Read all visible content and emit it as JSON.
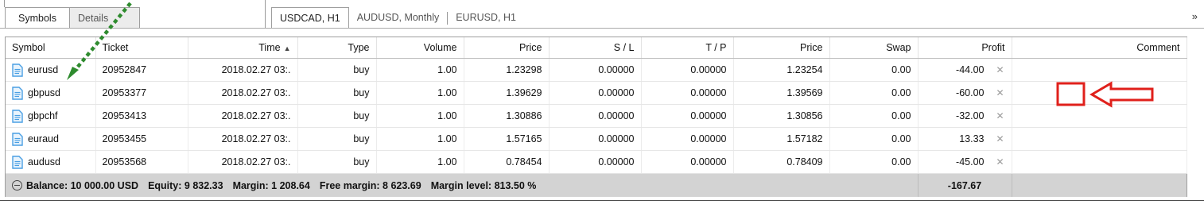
{
  "top_tabs": {
    "left": [
      {
        "label": "Symbols",
        "active": true
      },
      {
        "label": "Details",
        "active": false
      }
    ],
    "charts": [
      {
        "label": "USDCAD, H1",
        "active": true
      },
      {
        "label": "AUDUSD, Monthly",
        "active": false
      },
      {
        "label": "EURUSD, H1",
        "active": false
      }
    ],
    "more_label": "»"
  },
  "table": {
    "columns": [
      "Symbol",
      "Ticket",
      "Time",
      "Type",
      "Volume",
      "Price",
      "S / L",
      "T / P",
      "Price",
      "Swap",
      "Profit",
      "Comment"
    ],
    "sort_indicator": "▲",
    "close_glyph": "✕",
    "rows": [
      {
        "symbol": "eurusd",
        "ticket": "20952847",
        "time": "2018.02.27 03:.",
        "type": "buy",
        "volume": "1.00",
        "price": "1.23298",
        "sl": "0.00000",
        "tp": "0.00000",
        "price_current": "1.23254",
        "swap": "0.00",
        "profit": "-44.00",
        "comment": ""
      },
      {
        "symbol": "gbpusd",
        "ticket": "20953377",
        "time": "2018.02.27 03:.",
        "type": "buy",
        "volume": "1.00",
        "price": "1.39629",
        "sl": "0.00000",
        "tp": "0.00000",
        "price_current": "1.39569",
        "swap": "0.00",
        "profit": "-60.00",
        "comment": ""
      },
      {
        "symbol": "gbpchf",
        "ticket": "20953413",
        "time": "2018.02.27 03:.",
        "type": "buy",
        "volume": "1.00",
        "price": "1.30886",
        "sl": "0.00000",
        "tp": "0.00000",
        "price_current": "1.30856",
        "swap": "0.00",
        "profit": "-32.00",
        "comment": ""
      },
      {
        "symbol": "euraud",
        "ticket": "20953455",
        "time": "2018.02.27 03:.",
        "type": "buy",
        "volume": "1.00",
        "price": "1.57165",
        "sl": "0.00000",
        "tp": "0.00000",
        "price_current": "1.57182",
        "swap": "0.00",
        "profit": "13.33",
        "comment": ""
      },
      {
        "symbol": "audusd",
        "ticket": "20953568",
        "time": "2018.02.27 03:.",
        "type": "buy",
        "volume": "1.00",
        "price": "0.78454",
        "sl": "0.00000",
        "tp": "0.00000",
        "price_current": "0.78409",
        "swap": "0.00",
        "profit": "-45.00",
        "comment": ""
      }
    ]
  },
  "summary": {
    "balance": "Balance: 10 000.00 USD",
    "equity": "Equity: 9 832.33",
    "margin": "Margin: 1 208.64",
    "free_margin": "Free margin: 8 623.69",
    "margin_level": "Margin level: 813.50 %",
    "total_profit": "-167.67"
  },
  "colors": {
    "annotation_red": "#e0201b",
    "annotation_green": "#2e8b2e",
    "doc_icon_blue": "#4a9fe3",
    "summary_bg": "#d3d3d3"
  }
}
